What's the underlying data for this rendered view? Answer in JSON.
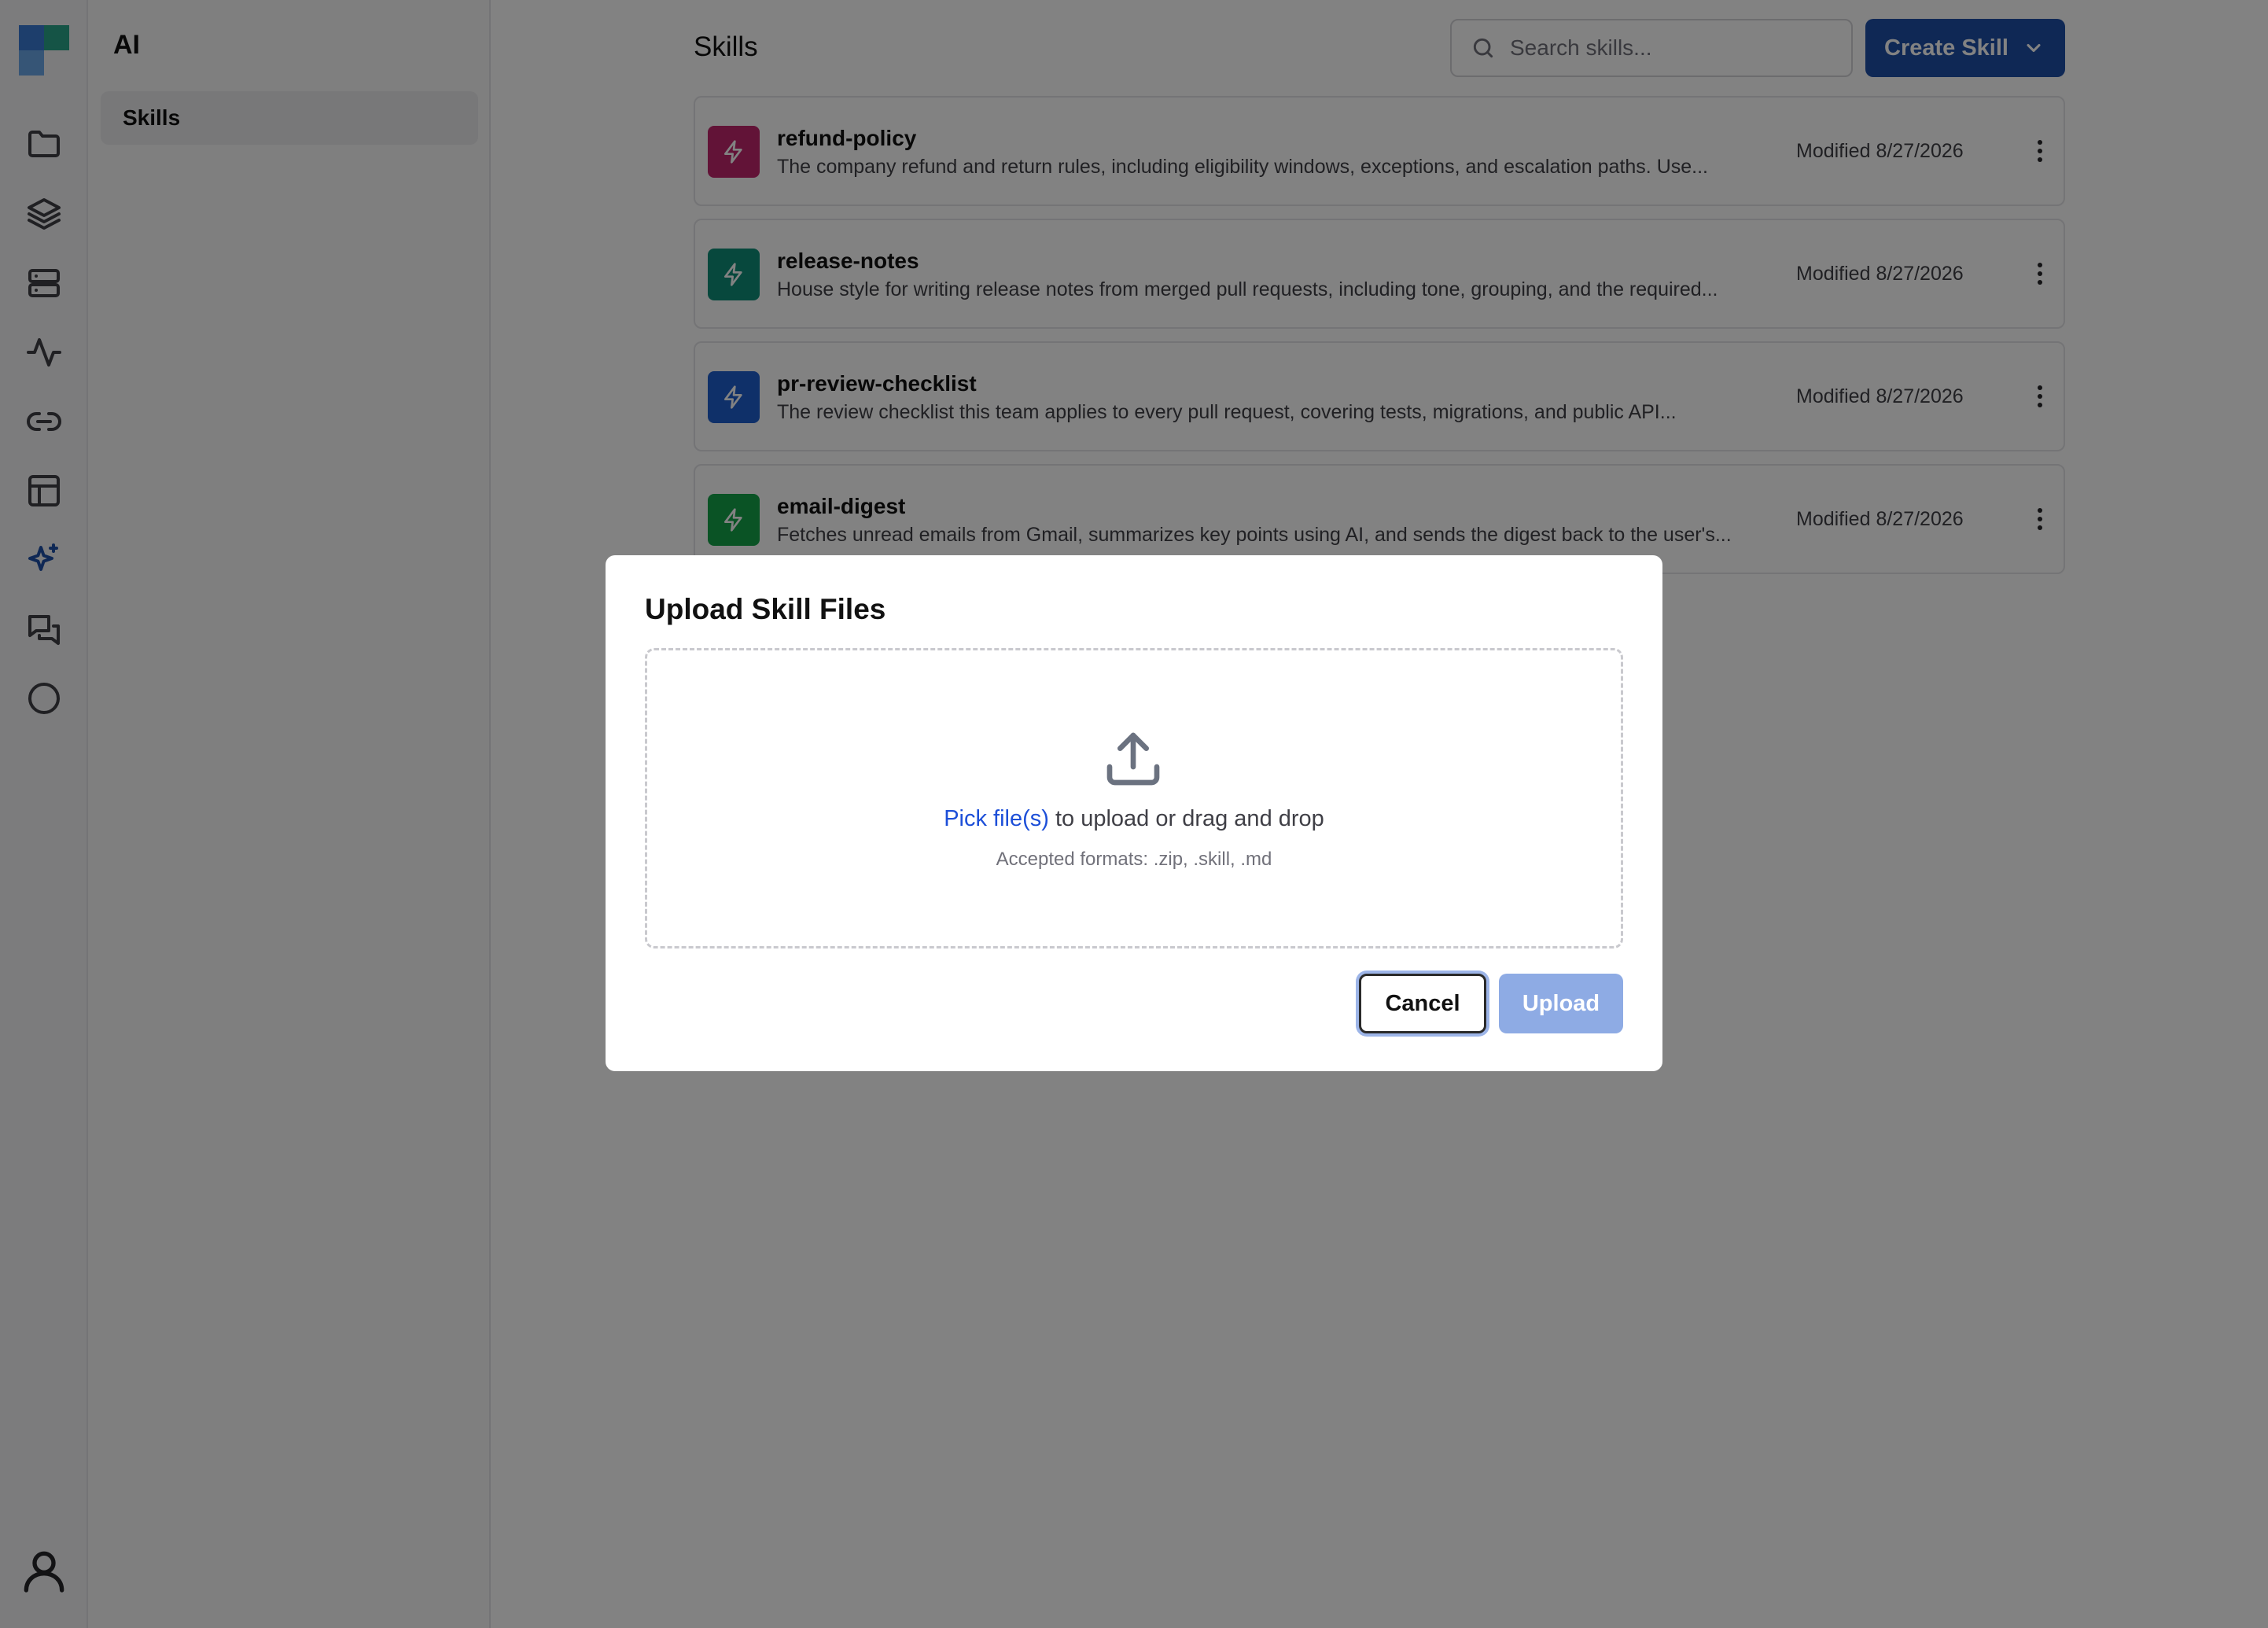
{
  "sidebar": {
    "title": "AI",
    "items": [
      {
        "label": "Skills"
      }
    ]
  },
  "header": {
    "title": "Skills",
    "search_placeholder": "Search skills...",
    "create_label": "Create Skill"
  },
  "skills": [
    {
      "name": "refund-policy",
      "description": "The company refund and return rules, including eligibility windows, exceptions, and escalation paths. Use...",
      "modified": "Modified 8/27/2026",
      "color": "#c0266d"
    },
    {
      "name": "release-notes",
      "description": "House style for writing release notes from merged pull requests, including tone, grouping, and the required...",
      "modified": "Modified 8/27/2026",
      "color": "#0f8e78"
    },
    {
      "name": "pr-review-checklist",
      "description": "The review checklist this team applies to every pull request, covering tests, migrations, and public API...",
      "modified": "Modified 8/27/2026",
      "color": "#1f5fce"
    },
    {
      "name": "email-digest",
      "description": "Fetches unread emails from Gmail, summarizes key points using AI, and sends the digest back to the user's...",
      "modified": "Modified 8/27/2026",
      "color": "#14a34a"
    }
  ],
  "dialog": {
    "title": "Upload Skill Files",
    "pick_link": "Pick file(s)",
    "drop_text": " to upload or drag and drop",
    "formats": "Accepted formats: .zip, .skill, .md",
    "cancel_label": "Cancel",
    "upload_label": "Upload"
  },
  "icons": {
    "rail": [
      "folder-icon",
      "layers-icon",
      "server-icon",
      "activity-icon",
      "link-icon",
      "layout-icon",
      "sparkles-icon",
      "messages-icon",
      "circle-icon",
      "user-icon"
    ],
    "skill": "zap-icon",
    "upload": "upload-icon"
  },
  "colors": {
    "accent": "#1e4fa8",
    "upload_disabled": "#8eabe4",
    "link": "#1d4fd8"
  }
}
